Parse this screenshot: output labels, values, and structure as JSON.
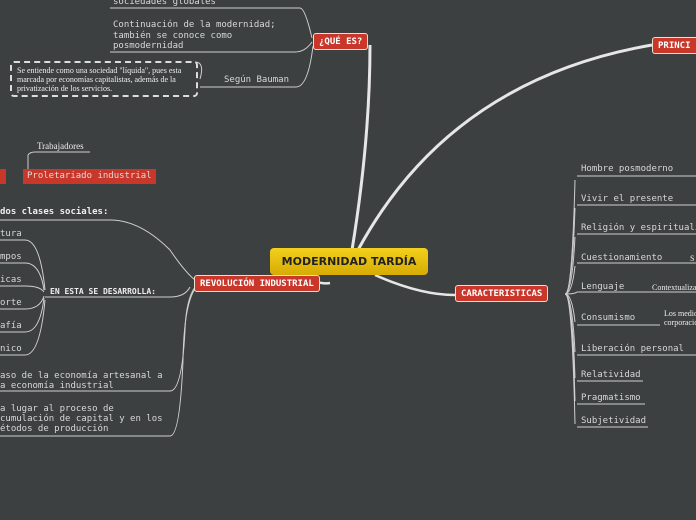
{
  "central": "MODERNIDAD TARDÍA",
  "que_es": {
    "label": "¿QUÉ ES?",
    "items": [
      "sociedades globales",
      "Continuación de la modernidad;",
      "también se conoce como",
      "posmodernidad",
      "Según Bauman"
    ],
    "bauman_note": [
      "Se entiende como una sociedad \"líquida\", pues esta",
      "marcada por economías capitalistas, además de la",
      "privatización de los servicios."
    ]
  },
  "principios": {
    "label": "PRINCI"
  },
  "revolucion": {
    "label": "REVOLUCIÓN INDUSTRIAL",
    "trabajadores": "Trabajadores",
    "proletariado": "Proletariado industrial",
    "dos_clases": "dos clases sociales:",
    "en_esta": "EN ESTA SE DESARROLLA:",
    "develops": [
      "tura",
      "mpos",
      "icas",
      "orte",
      "afía",
      "nico"
    ],
    "paso": [
      "aso de la economía artesanal a",
      "a economía industrial"
    ],
    "da_lugar": [
      "a lugar al proceso de",
      "cumulación de capital y en los",
      "étodos de producción"
    ]
  },
  "caracteristicas": {
    "label": "CARACTERISTICAS",
    "items": [
      "Hombre posmoderno",
      "Vivir el presente",
      "Religión y espirituali",
      "Cuestionamiento",
      "Lenguaje",
      "Consumismo",
      "Liberación personal",
      "Relatividad",
      "Pragmatismo",
      "Subjetividad"
    ],
    "cuestionamiento_sub": "S",
    "lenguaje_sub": "Contextualiza",
    "consumismo_sub": [
      "Los medios",
      "corporació"
    ]
  },
  "colors": {
    "background": "#3d4040",
    "node": "#c9362a",
    "central": "#f0c814",
    "lines": "#c8c8c8"
  }
}
